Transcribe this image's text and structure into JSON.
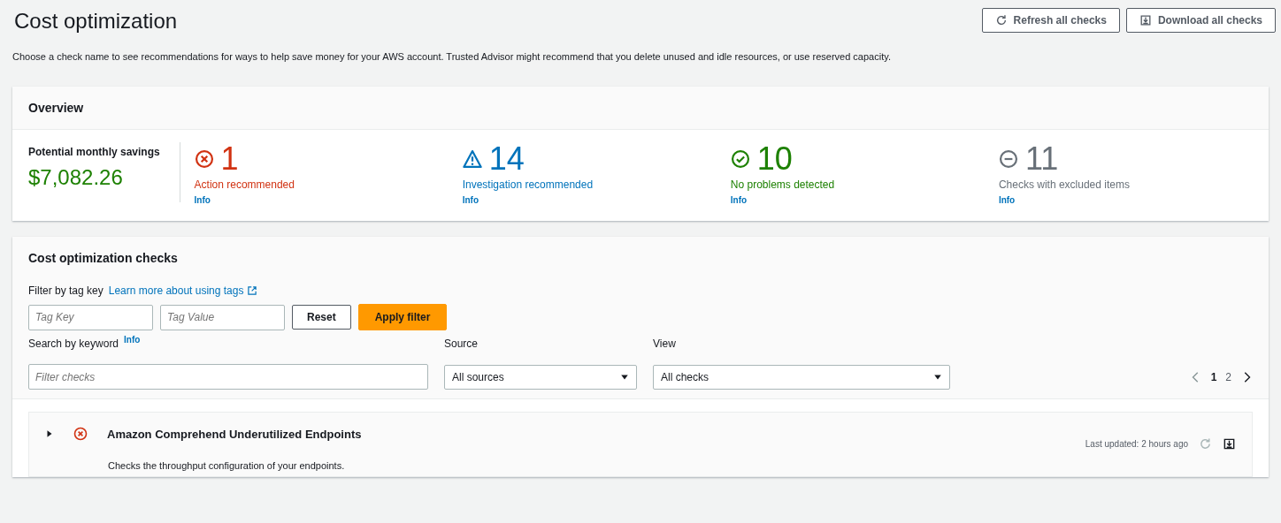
{
  "page": {
    "title": "Cost optimization",
    "description": "Choose a check name to see recommendations for ways to help save money for your AWS account. Trusted Advisor might recommend that you delete unused and idle resources, or use reserved capacity.",
    "buttons": [
      {
        "kind": "refresh",
        "label": "Refresh all checks"
      },
      {
        "kind": "download",
        "label": "Download all checks"
      }
    ]
  },
  "overview": {
    "title": "Overview",
    "savings_label": "Potential monthly savings",
    "savings_value": "$7,082.26",
    "stats": [
      {
        "kind": "error",
        "count": "1",
        "label": "Action recommended",
        "info": "Info"
      },
      {
        "kind": "warning",
        "count": "14",
        "label": "Investigation recommended",
        "info": "Info"
      },
      {
        "kind": "success",
        "count": "10",
        "label": "No problems detected",
        "info": "Info"
      },
      {
        "kind": "excluded",
        "count": "11",
        "label": "Checks with excluded items",
        "info": "Info"
      }
    ]
  },
  "checks": {
    "title": "Cost optimization checks",
    "filter_label": "Filter by tag key",
    "filter_link": "Learn more about using tags",
    "tag_key": {
      "placeholder": "Tag Key"
    },
    "tag_value": {
      "placeholder": "Tag Value"
    },
    "reset": "Reset",
    "apply": "Apply filter",
    "search_label": "Search by keyword",
    "search_info": "Info",
    "search": {
      "placeholder": "Filter checks"
    },
    "source": {
      "label": "Source",
      "value": "All sources"
    },
    "view": {
      "label": "View",
      "value": "All checks"
    },
    "pages": [
      {
        "label": "1",
        "selected": true
      },
      {
        "label": "2",
        "selected": false
      }
    ],
    "items": [
      {
        "kind": "error",
        "expanded": false,
        "name": "Amazon Comprehend Underutilized Endpoints",
        "description": "Checks the throughput configuration of your endpoints.",
        "updated": "Last updated: 2 hours ago"
      }
    ]
  }
}
